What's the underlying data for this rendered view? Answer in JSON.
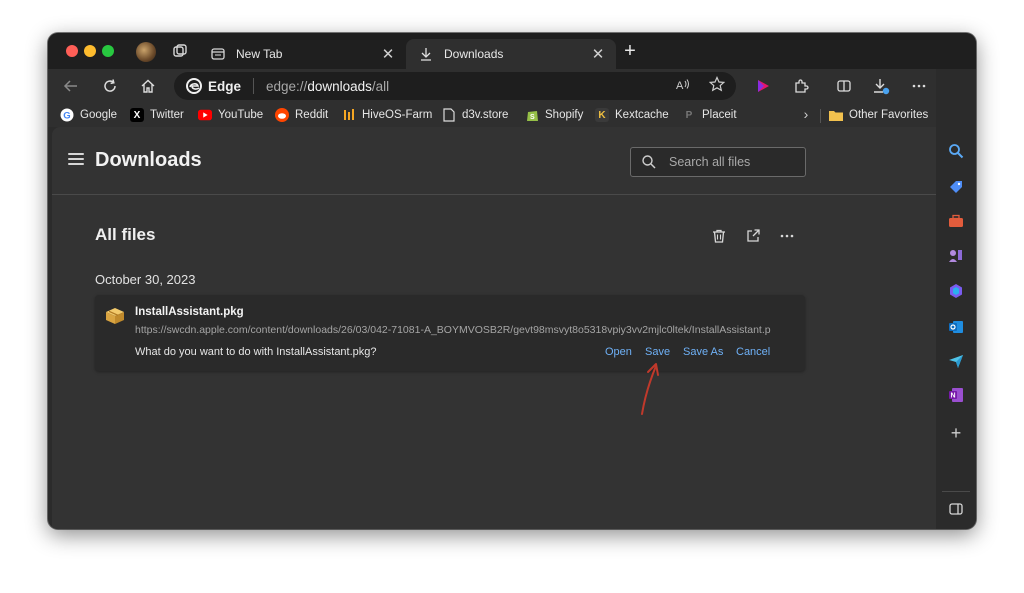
{
  "tabs": [
    {
      "title": "New Tab",
      "icon": "newtab-icon"
    },
    {
      "title": "Downloads",
      "icon": "download-icon"
    }
  ],
  "address_bar": {
    "site_chip": "Edge",
    "url_prefix": "edge://",
    "url_host": "downloads",
    "url_path": "/all"
  },
  "favorites": [
    {
      "label": "Google",
      "icon": "google-icon"
    },
    {
      "label": "Twitter",
      "icon": "x-icon"
    },
    {
      "label": "YouTube",
      "icon": "youtube-icon"
    },
    {
      "label": "Reddit",
      "icon": "reddit-icon"
    },
    {
      "label": "HiveOS-Farm",
      "icon": "hiveos-icon"
    },
    {
      "label": "d3v.store",
      "icon": "page-icon"
    },
    {
      "label": "Shopify",
      "icon": "shopify-icon"
    },
    {
      "label": "Kextcache",
      "icon": "kextcache-icon"
    },
    {
      "label": "Placeit",
      "icon": "placeit-icon"
    },
    {
      "label": "Other Favorites",
      "icon": "folder-icon"
    }
  ],
  "downloads_page": {
    "title": "Downloads",
    "search_placeholder": "Search all files",
    "section_title": "All files",
    "date_group": "October 30, 2023",
    "item": {
      "file_name": "InstallAssistant.pkg",
      "url": "https://swcdn.apple.com/content/downloads/26/03/042-71081-A_BOYMVOSB2R/gevt98msvyt8o5318vpiy3vv2mjlc0ltek/InstallAssistant.pkg",
      "prompt": "What do you want to do with InstallAssistant.pkg?",
      "actions": {
        "open": "Open",
        "save": "Save",
        "save_as": "Save As",
        "cancel": "Cancel"
      }
    }
  },
  "colors": {
    "link": "#6fb1f7",
    "annotation_arrow": "#c0392b"
  }
}
